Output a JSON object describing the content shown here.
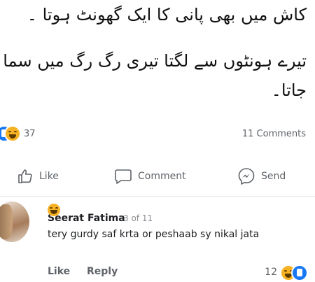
{
  "post": {
    "lines": [
      "کاش میں بھی پانی کا ایک گھونٹ ہوتا ۔",
      "تیرے ہونٹوں سے لگتا تیری رگ رگ میں سما",
      "جاتا۔"
    ]
  },
  "stats": {
    "reaction_count": "37",
    "comments_count": "11 Comments",
    "reaction_icons": [
      "like-icon",
      "haha-icon"
    ]
  },
  "actions": {
    "like_label": "Like",
    "comment_label": "Comment",
    "send_label": "Send"
  },
  "comment": {
    "author": "Seerat Fatima",
    "index": "3 of 11",
    "text": "tery gurdy saf krta or peshaab sy nikal jata",
    "emoji": "haha-icon",
    "like_label": "Like",
    "reply_label": "Reply",
    "reaction_count": "12"
  },
  "colors": {
    "like_blue": "#1877f2",
    "haha_yellow": "#f7b125",
    "secondary_text": "#5f6368"
  }
}
